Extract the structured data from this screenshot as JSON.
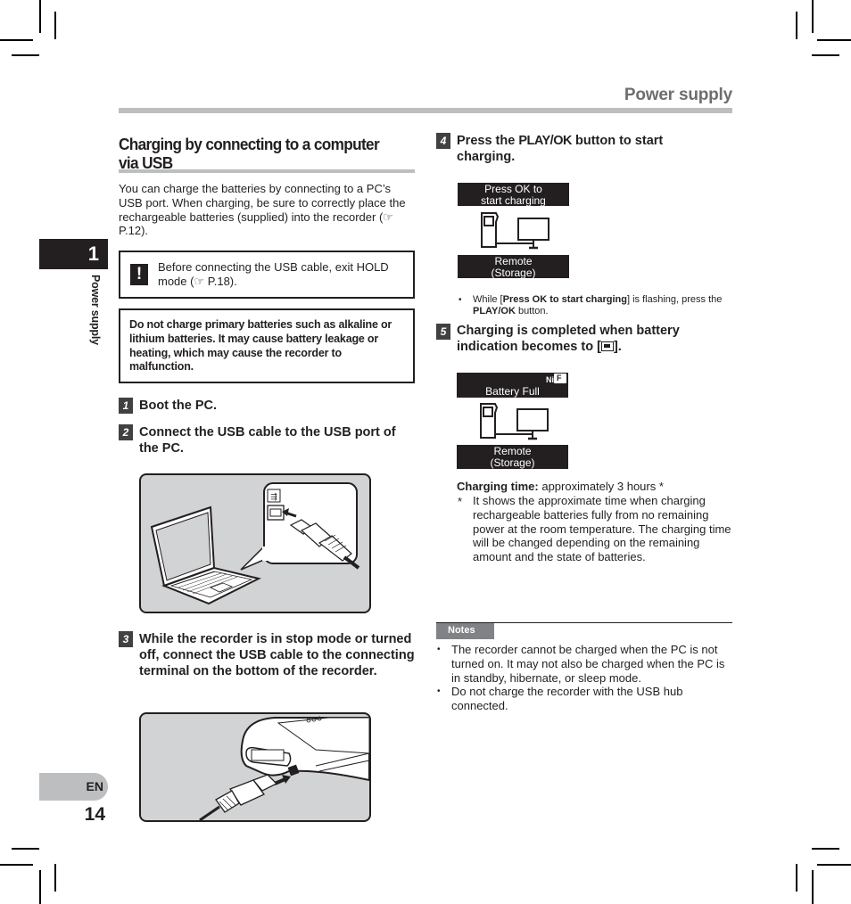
{
  "header": {
    "title": "Power supply"
  },
  "chapter": {
    "number": "1",
    "label": "Power supply"
  },
  "footer": {
    "language": "EN",
    "page_number": "14"
  },
  "section": {
    "title": "Charging by connecting to a computer via USB",
    "intro": "You can charge the batteries by connecting to a PC’s USB port. When charging, be sure to correctly place the rechargeable batteries (supplied) into the recorder (☞ P.12).",
    "caution": {
      "icon": "exclamation-icon",
      "text": "Before connecting the USB cable, exit HOLD mode (☞ P.18)."
    },
    "warning": "Do not charge primary batteries such as alkaline or lithium batteries. It may cause battery leakage or heating, which may cause the recorder to malfunction."
  },
  "steps": [
    {
      "number": "1",
      "text": "Boot the PC."
    },
    {
      "number": "2",
      "text": "Connect the USB cable to the USB port of the PC."
    },
    {
      "number": "3",
      "text": "While the recorder is in stop mode or turned off, connect the USB cable to the connecting terminal on the bottom of the recorder."
    },
    {
      "number": "4",
      "text_pre": "Press the ",
      "text_key": "PLAY/OK",
      "text_post": " button to start charging."
    },
    {
      "number": "5",
      "text_pre": "Charging is completed when battery indication becomes to [",
      "text_post": "]."
    }
  ],
  "illustrations": {
    "laptop": "laptop-usb-connection-illustration",
    "recorder": "recorder-usb-connection-illustration"
  },
  "screen_press_ok": {
    "top_line1": "Press OK to",
    "top_line2": "start charging",
    "bottom_line1": "Remote",
    "bottom_line2": "(Storage)"
  },
  "step4_note": {
    "pre": "While [",
    "bold": "Press OK to start charging",
    "mid": "] is flashing, press the ",
    "key": "PLAY/OK",
    "post": " button."
  },
  "screen_battery_full": {
    "indicator": "Ni",
    "battery_glyph": "F",
    "top_line": "Battery Full",
    "bottom_line1": "Remote",
    "bottom_line2": "(Storage)"
  },
  "charging_time": {
    "label": "Charging time:",
    "value": " approximately 3 hours *",
    "footnote_mark": "*",
    "footnote": "It shows the approximate time when charging rechargeable batteries fully from no remaining power at the room temperature. The charging time will be changed depending on the remaining amount and the state of batteries."
  },
  "notes": {
    "label": "Notes",
    "items": [
      "The recorder cannot be charged when the PC is not turned on. It may not also be charged when the PC is in standby, hibernate, or sleep mode.",
      "Do not charge the recorder with the USB hub connected."
    ]
  },
  "colors": {
    "text": "#231f20",
    "rule_gray": "#bcbec0",
    "header_gray": "#6d6e70",
    "step_badge": "#414042",
    "notes_badge": "#808285",
    "illustration_bg": "#d1d3d4"
  }
}
